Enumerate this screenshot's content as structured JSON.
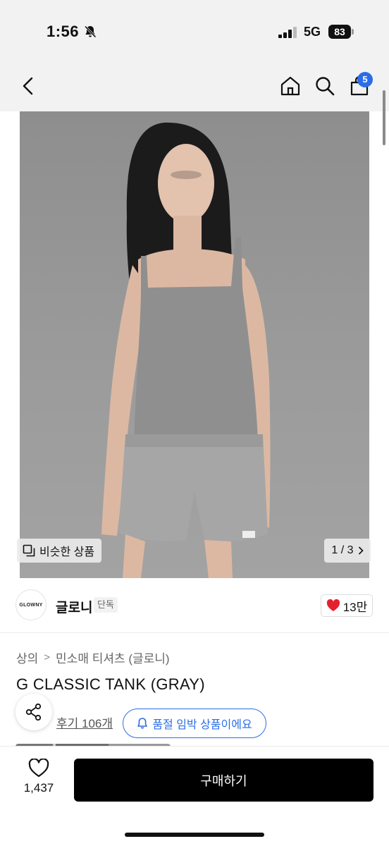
{
  "status_bar": {
    "time": "1:56",
    "network": "5G",
    "battery": "83"
  },
  "header": {
    "cart_count": "5"
  },
  "product_image": {
    "similar_label": "비슷한 상품",
    "page_indicator": "1 / 3"
  },
  "brand": {
    "logo_text": "GLOWNY",
    "name": "글로니",
    "badge": "단독",
    "likes": "13만",
    "heart_color": "#e5202e"
  },
  "product": {
    "breadcrumb": [
      "상의",
      "민소매 티셔츠 (글로니)"
    ],
    "title": "G CLASSIC TANK (GRAY)",
    "review": "후기 106개",
    "soldout_notice": "품절 임박 상품이에요"
  },
  "bottom_bar": {
    "wish_count": "1,437",
    "buy_label": "구매하기"
  },
  "colors": {
    "accent": "#2b6de8",
    "buy_button": "#000000"
  }
}
